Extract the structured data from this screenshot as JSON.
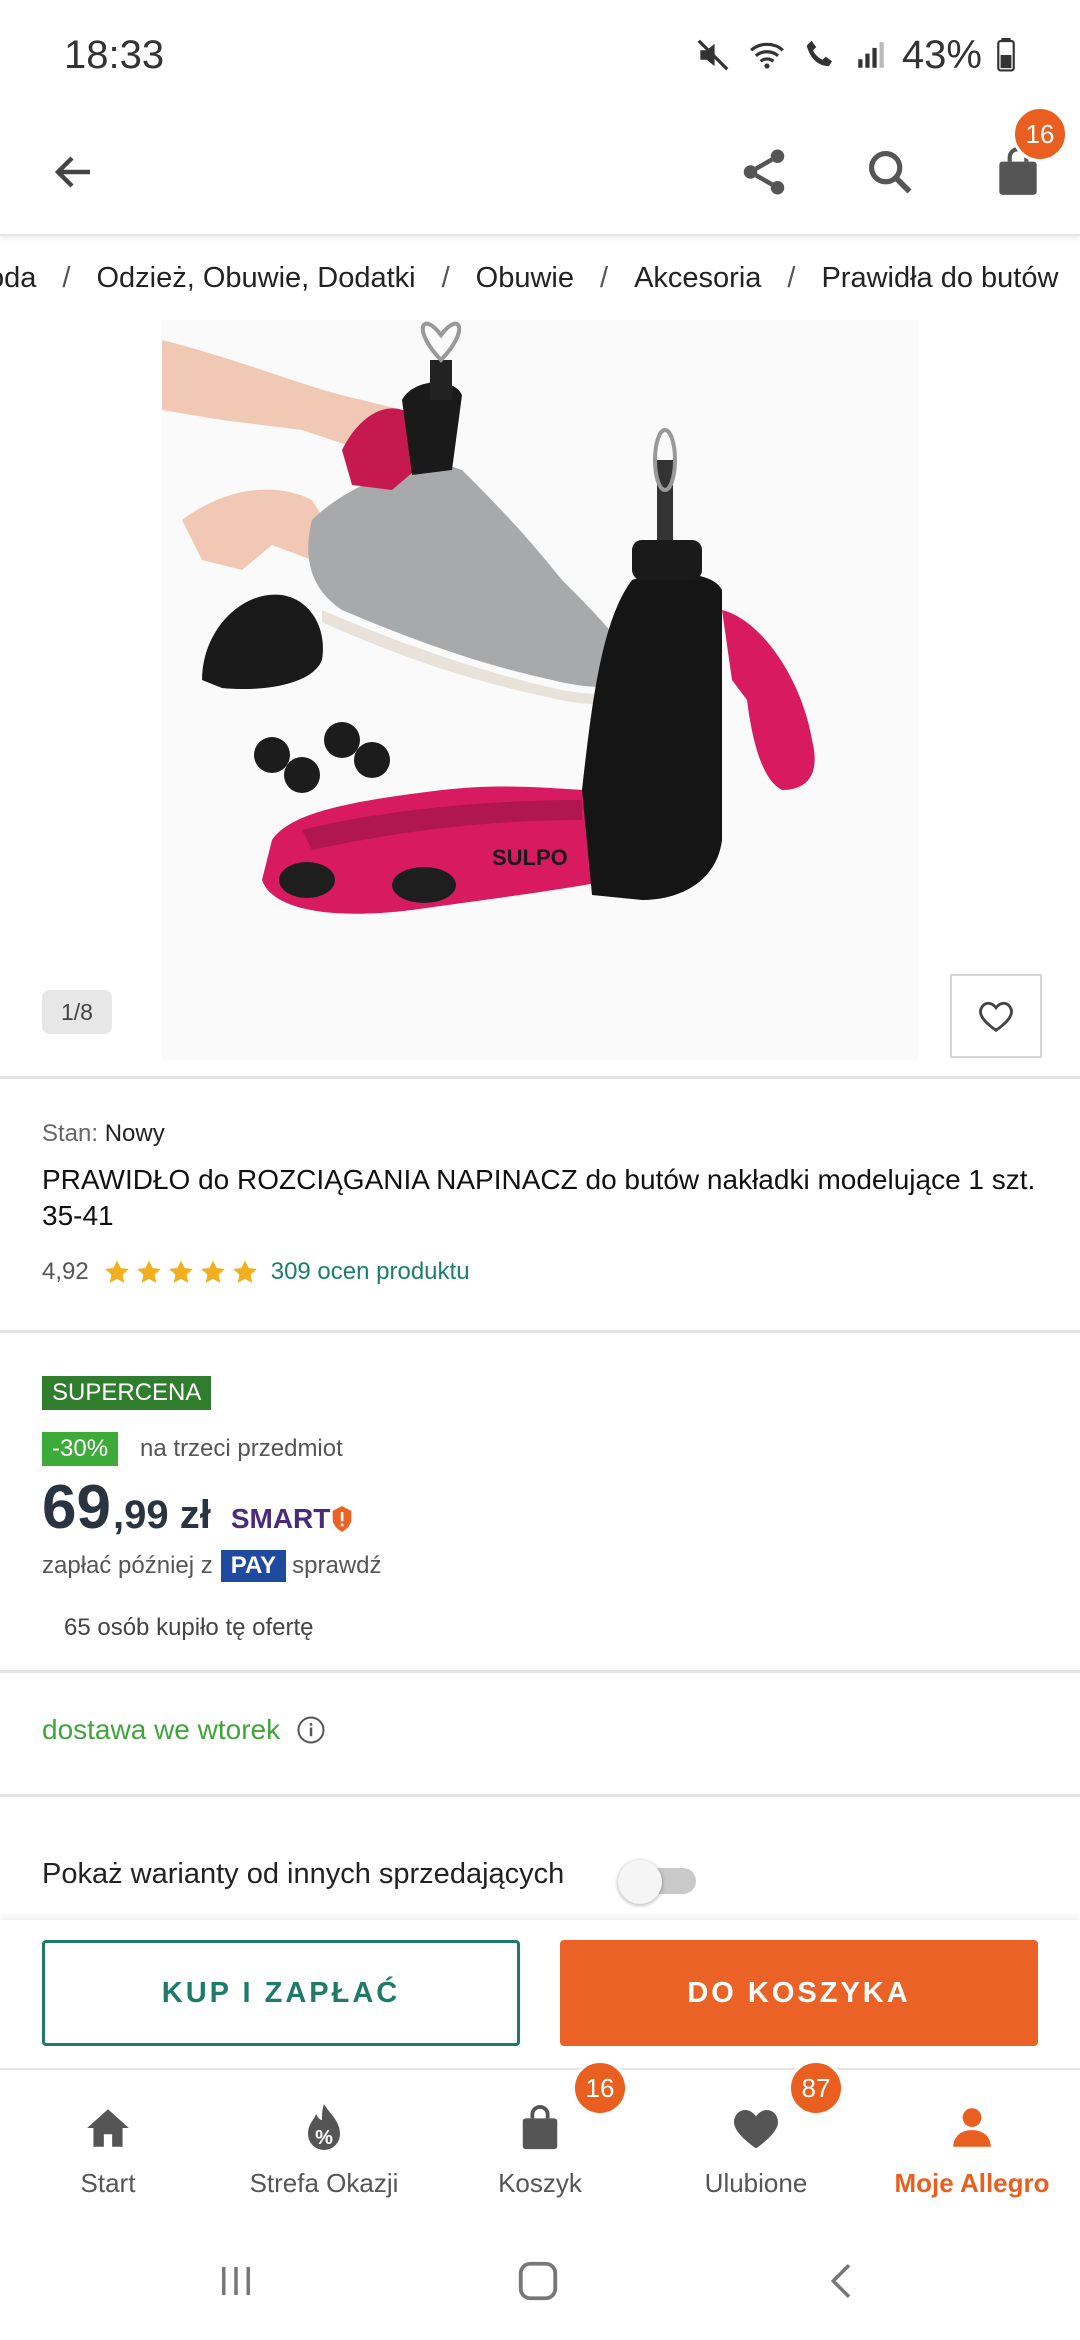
{
  "status_bar": {
    "time": "18:33",
    "battery": "43%",
    "icons": [
      "mute-icon",
      "wifi-icon",
      "wifi-call-icon",
      "signal-icon",
      "battery-icon"
    ]
  },
  "app_bar": {
    "cart_badge": "16",
    "icons": [
      "back-arrow-icon",
      "share-icon",
      "search-icon",
      "shopping-bag-icon"
    ]
  },
  "breadcrumb": [
    "oda",
    "Odzież, Obuwie, Dodatki",
    "Obuwie",
    "Akcesoria",
    "Prawidła do butów"
  ],
  "gallery": {
    "counter": "1/8",
    "image_brand_text": "SULPO"
  },
  "product": {
    "condition_label": "Stan:",
    "condition_value": "Nowy",
    "title": "PRAWIDŁO do ROZCIĄGANIA NAPINACZ do butów nakładki modelujące 1 szt. 35-41",
    "rating": "4,92",
    "stars": 5,
    "rating_count": "309 ocen produktu"
  },
  "price": {
    "tag": "SUPERCENA",
    "discount": "-30%",
    "discount_note": "na trzeci przedmiot",
    "main": "69",
    "rest": ",99 zł",
    "smart": "SMART",
    "pay_later_prefix": "zapłać później z",
    "pay_badge": "PAY",
    "pay_later_suffix": "sprawdź",
    "bought": "65 osób kupiło tę ofertę"
  },
  "delivery": {
    "text": "dostawa we wtorek"
  },
  "variants": {
    "label": "Pokaż warianty od innych sprzedających",
    "enabled": false
  },
  "actions": {
    "buy": "KUP I ZAPŁAĆ",
    "cart": "DO KOSZYKA"
  },
  "bottom_nav": [
    {
      "label": "Start",
      "icon": "home-icon"
    },
    {
      "label": "Strefa Okazji",
      "icon": "deals-icon"
    },
    {
      "label": "Koszyk",
      "icon": "shopping-bag-icon",
      "badge": "16"
    },
    {
      "label": "Ulubione",
      "icon": "heart-icon",
      "badge": "87"
    },
    {
      "label": "Moje Allegro",
      "icon": "user-icon",
      "active": true
    }
  ],
  "colors": {
    "accent": "#e95f1f",
    "teal": "#1f7a6a",
    "green": "#3fa53a",
    "supercena_bg": "#2f7d2d"
  }
}
